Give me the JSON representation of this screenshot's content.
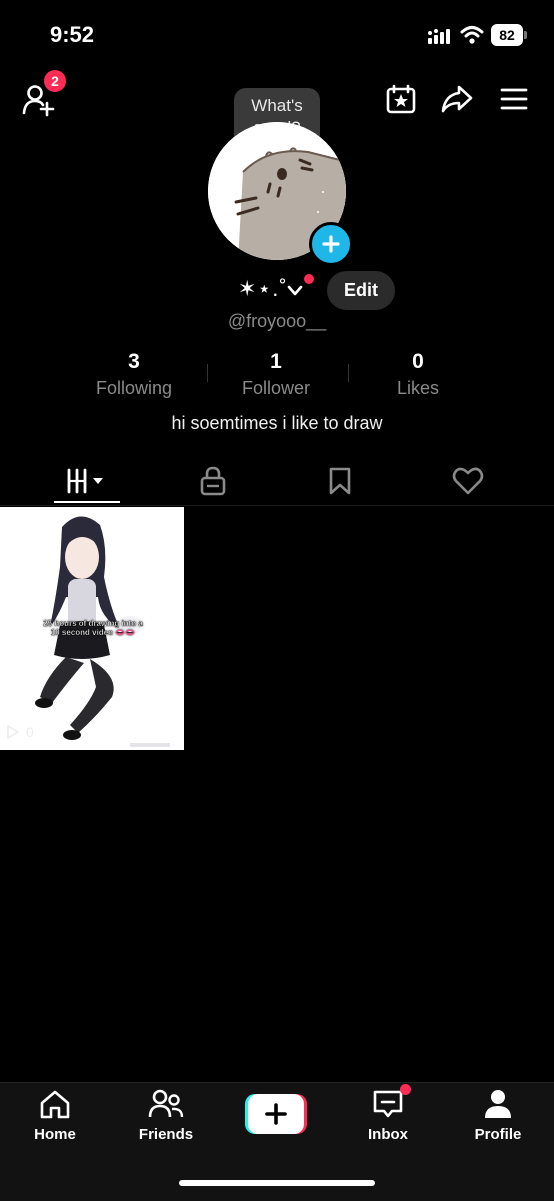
{
  "status_bar": {
    "time": "9:52",
    "battery": "82"
  },
  "header": {
    "friend_requests_badge": "2",
    "story_prompt_line1": "What's",
    "story_prompt_line2": "good?"
  },
  "profile": {
    "display_name": "✶⋆.˚",
    "edit_label": "Edit",
    "username": "@froyooo__",
    "bio": "hi soemtimes i like to draw",
    "stats": [
      {
        "value": "3",
        "label": "Following"
      },
      {
        "value": "1",
        "label": "Follower"
      },
      {
        "value": "0",
        "label": "Likes"
      }
    ]
  },
  "tabs": [
    "videos-grid-icon",
    "lock-icon",
    "bookmark-icon",
    "heart-icon"
  ],
  "videos": [
    {
      "caption": "25 hours of drawing into a 10 second video 👄👄",
      "views": "0"
    }
  ],
  "bottom_nav": [
    {
      "label": "Home",
      "icon": "home-icon"
    },
    {
      "label": "Friends",
      "icon": "friends-icon"
    },
    {
      "label": "",
      "icon": "create-plus-icon"
    },
    {
      "label": "Inbox",
      "icon": "inbox-icon"
    },
    {
      "label": "Profile",
      "icon": "profile-icon"
    }
  ],
  "colors": {
    "accent": "#fe2c55",
    "story_plus": "#1fb6e8",
    "background": "#000000"
  }
}
